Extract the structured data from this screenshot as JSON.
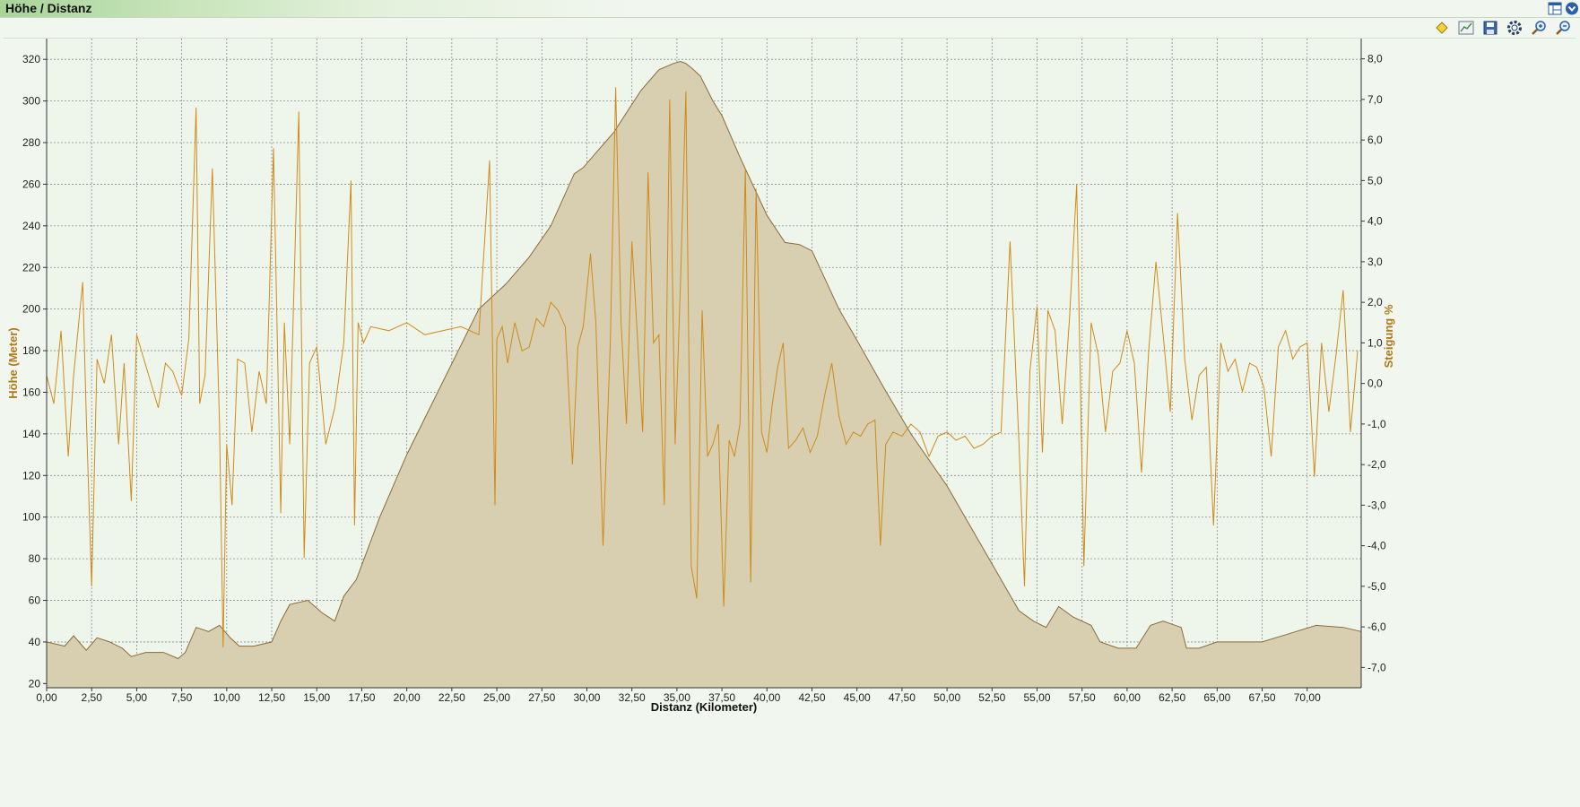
{
  "window": {
    "title": "Höhe / Distanz"
  },
  "icons": {
    "layout": "layout-icon",
    "menu": "dropdown-circle-icon",
    "diamond": "diamond-marker-icon",
    "chart": "chart-icon",
    "save": "save-icon",
    "settings": "settings-gear-icon",
    "zoom_in": "zoom-in-icon",
    "zoom_out": "zoom-out-icon"
  },
  "colors": {
    "area_fill": "#d8cfb0",
    "area_line": "#8a6a3a",
    "grade_line": "#d08a1a",
    "axis_title": "#b07a1a",
    "grid": "#8c8c8c"
  },
  "chart_data": {
    "type": "area",
    "xlabel": "Distanz (Kilometer)",
    "ylabel": "Höhe (Meter)",
    "y2label": "Steigung %",
    "xlim": [
      0,
      73
    ],
    "ylim": [
      18,
      330
    ],
    "y2lim": [
      -7.5,
      8.5
    ],
    "x_ticks": [
      "0,00",
      "2,50",
      "5,00",
      "7,50",
      "10,00",
      "12,50",
      "15,00",
      "17,50",
      "20,00",
      "22,50",
      "25,00",
      "27,50",
      "30,00",
      "32,50",
      "35,00",
      "37,50",
      "40,00",
      "42,50",
      "45,00",
      "47,50",
      "50,00",
      "52,50",
      "55,00",
      "57,50",
      "60,00",
      "62,50",
      "65,00",
      "67,50",
      "70,00"
    ],
    "y_ticks": [
      "20",
      "40",
      "60",
      "80",
      "100",
      "120",
      "140",
      "160",
      "180",
      "200",
      "220",
      "240",
      "260",
      "280",
      "300",
      "320"
    ],
    "y2_ticks": [
      "-7,0",
      "-6,0",
      "-5,0",
      "-4,0",
      "-3,0",
      "-2,0",
      "-1,0",
      "0,0",
      "1,0",
      "2,0",
      "3,0",
      "4,0",
      "5,0",
      "6,0",
      "7,0",
      "8,0"
    ],
    "grid": true,
    "series": [
      {
        "name": "Höhe (Meter)",
        "type": "area",
        "x": [
          0,
          1,
          1.5,
          2.2,
          2.8,
          3.5,
          4.2,
          4.7,
          5.5,
          6.5,
          7.3,
          7.7,
          8.3,
          9.0,
          9.6,
          10.2,
          10.7,
          11.5,
          12.5,
          13.0,
          13.5,
          14.5,
          15.3,
          16.0,
          16.5,
          17.2,
          18.5,
          20.0,
          22.0,
          24.0,
          25.5,
          26.8,
          28.0,
          29.3,
          29.8,
          30.5,
          31.5,
          33.0,
          34.0,
          34.8,
          35.2,
          35.5,
          35.8,
          36.3,
          37.0,
          37.5,
          38.5,
          40.0,
          41.0,
          41.8,
          42.5,
          44.0,
          45.0,
          46.5,
          48.0,
          50.0,
          52.0,
          54.0,
          54.8,
          55.5,
          56.2,
          57.0,
          58.0,
          58.5,
          59.5,
          60.5,
          61.3,
          62.0,
          63.0,
          63.3,
          64.0,
          65.0,
          67.0,
          67.5,
          69.0,
          70.5,
          72.0,
          73.0
        ],
        "y": [
          40,
          38,
          43,
          36,
          42,
          40,
          37,
          33,
          35,
          35,
          32,
          35,
          47,
          45,
          48,
          42,
          38,
          38,
          40,
          50,
          58,
          60,
          54,
          50,
          62,
          70,
          100,
          130,
          165,
          200,
          212,
          225,
          240,
          265,
          268,
          275,
          285,
          305,
          315,
          318,
          319,
          318,
          316,
          312,
          300,
          293,
          273,
          245,
          232,
          231,
          228,
          200,
          185,
          162,
          140,
          115,
          85,
          55,
          50,
          47,
          57,
          52,
          48,
          40,
          37,
          37,
          48,
          50,
          47,
          37,
          37,
          40,
          40,
          40,
          44,
          48,
          47,
          45
        ]
      },
      {
        "name": "Steigung %",
        "type": "line",
        "x": [
          0,
          0.4,
          0.8,
          1.2,
          1.5,
          2.0,
          2.2,
          2.5,
          2.8,
          3.2,
          3.6,
          4.0,
          4.3,
          4.7,
          5.0,
          5.4,
          5.8,
          6.2,
          6.6,
          7.0,
          7.5,
          7.9,
          8.3,
          8.5,
          8.8,
          9.2,
          9.6,
          9.8,
          10.0,
          10.3,
          10.6,
          11.0,
          11.4,
          11.8,
          12.2,
          12.6,
          13.0,
          13.2,
          13.5,
          14.0,
          14.3,
          14.6,
          15.0,
          15.5,
          16.0,
          16.5,
          16.9,
          17.1,
          17.3,
          17.6,
          18.0,
          19.0,
          20.0,
          21.0,
          22.0,
          23.0,
          24.0,
          24.6,
          24.9,
          25.0,
          25.3,
          25.6,
          26.0,
          26.4,
          26.8,
          27.2,
          27.6,
          28.0,
          28.4,
          28.8,
          29.2,
          29.5,
          29.8,
          30.2,
          30.5,
          30.9,
          31.3,
          31.6,
          31.9,
          32.2,
          32.5,
          32.8,
          33.1,
          33.4,
          33.7,
          34.0,
          34.3,
          34.6,
          34.9,
          35.2,
          35.5,
          35.8,
          36.1,
          36.4,
          36.7,
          37.0,
          37.3,
          37.6,
          37.9,
          38.2,
          38.5,
          38.8,
          39.1,
          39.4,
          39.7,
          40.0,
          40.3,
          40.6,
          40.9,
          41.2,
          41.6,
          42.0,
          42.4,
          42.8,
          43.2,
          43.6,
          44.0,
          44.4,
          44.8,
          45.2,
          45.6,
          46.0,
          46.3,
          46.6,
          47.0,
          47.5,
          48.0,
          48.5,
          49.0,
          49.5,
          50.0,
          50.5,
          51.0,
          51.5,
          52.0,
          52.5,
          53.0,
          53.5,
          54.0,
          54.3,
          54.6,
          55.0,
          55.3,
          55.6,
          56.0,
          56.4,
          56.8,
          57.2,
          57.6,
          58.0,
          58.4,
          58.8,
          59.2,
          59.6,
          60.0,
          60.4,
          60.8,
          61.2,
          61.6,
          62.0,
          62.4,
          62.8,
          63.2,
          63.6,
          64.0,
          64.4,
          64.8,
          65.2,
          65.6,
          66.0,
          66.4,
          66.8,
          67.2,
          67.6,
          68.0,
          68.4,
          68.8,
          69.2,
          69.6,
          70.0,
          70.4,
          70.8,
          71.2,
          71.6,
          72.0,
          72.4,
          72.8
        ],
        "y": [
          0.2,
          -0.5,
          1.3,
          -1.8,
          0.2,
          2.5,
          -0.8,
          -5.0,
          0.6,
          0,
          1.2,
          -1.5,
          0.5,
          -2.9,
          1.2,
          0.6,
          0,
          -0.6,
          0.5,
          0.3,
          -0.3,
          1.1,
          6.8,
          -0.5,
          0.2,
          5.3,
          -1.0,
          -6.5,
          -1.5,
          -3.0,
          0.6,
          0.5,
          -1.2,
          0.3,
          -0.5,
          5.8,
          -3.2,
          1.5,
          -1.5,
          6.7,
          -4.3,
          0.5,
          0.9,
          -1.5,
          -0.6,
          1.0,
          5.0,
          -3.5,
          1.5,
          1.0,
          1.4,
          1.3,
          1.5,
          1.2,
          1.3,
          1.4,
          1.2,
          5.5,
          -3.0,
          1.1,
          1.4,
          0.5,
          1.5,
          0.8,
          0.9,
          1.6,
          1.4,
          2.0,
          1.8,
          1.4,
          -2.0,
          0.9,
          1.4,
          3.2,
          1.5,
          -4.0,
          1.0,
          7.3,
          1.5,
          -1.0,
          3.5,
          1.2,
          -1.2,
          5.2,
          1.0,
          1.2,
          -3.0,
          7.0,
          -1.5,
          2.5,
          7.2,
          -4.5,
          -5.3,
          1.8,
          -1.8,
          -1.5,
          -1.0,
          -5.5,
          -1.4,
          -1.8,
          -1.0,
          5.3,
          -4.9,
          4.8,
          -1.2,
          -1.7,
          -0.5,
          0.4,
          1.0,
          -1.6,
          -1.4,
          -1.1,
          -1.7,
          -1.3,
          -0.3,
          0.5,
          -0.8,
          -1.5,
          -1.2,
          -1.3,
          -1.0,
          -0.9,
          -4.0,
          -1.5,
          -1.2,
          -1.3,
          -1.0,
          -1.2,
          -1.8,
          -1.3,
          -1.2,
          -1.4,
          -1.3,
          -1.6,
          -1.5,
          -1.3,
          -1.2,
          3.5,
          -1.5,
          -5.0,
          0.3,
          1.9,
          -1.7,
          1.8,
          1.3,
          -1.0,
          1.6,
          4.9,
          -4.5,
          1.5,
          0.7,
          -1.2,
          0.3,
          0.5,
          1.3,
          0.5,
          -2.2,
          0.8,
          3.0,
          1.2,
          -0.7,
          4.2,
          0.6,
          -0.9,
          0.2,
          0.4,
          -3.5,
          1.0,
          0.3,
          0.6,
          -0.2,
          0.5,
          0.4,
          -0.1,
          -1.8,
          0.9,
          1.3,
          0.6,
          0.9,
          1.0,
          -2.3,
          1.0,
          -0.7,
          0.7,
          2.3,
          -1.2,
          0.8
        ]
      }
    ]
  }
}
